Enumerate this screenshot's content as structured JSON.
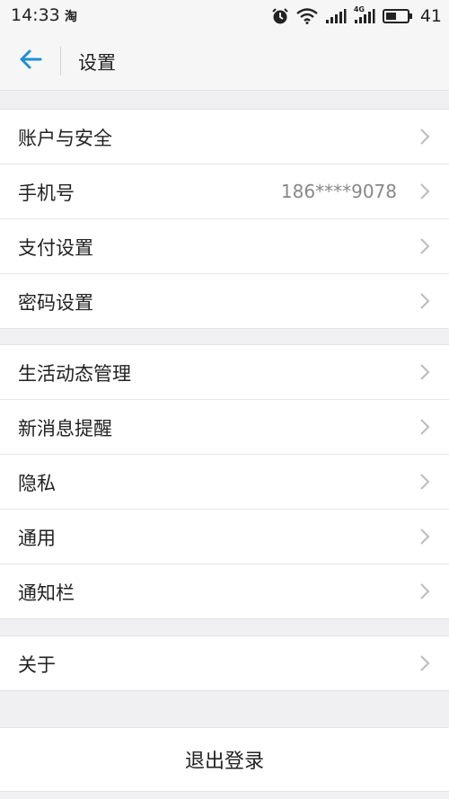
{
  "status_bar": {
    "time": "14:33",
    "app_glyph": "淘",
    "network": "4G",
    "battery_level": "41",
    "icons": [
      "alarm-icon",
      "wifi-icon",
      "signal-icon",
      "signal-4g-icon",
      "battery-icon"
    ]
  },
  "header": {
    "title": "设置",
    "back_icon": "back-arrow-icon",
    "accent_color": "#1e8fd6"
  },
  "groups": [
    {
      "items": [
        {
          "label": "账户与安全",
          "value": ""
        },
        {
          "label": "手机号",
          "value": "186****9078"
        },
        {
          "label": "支付设置",
          "value": ""
        },
        {
          "label": "密码设置",
          "value": ""
        }
      ]
    },
    {
      "items": [
        {
          "label": "生活动态管理",
          "value": ""
        },
        {
          "label": "新消息提醒",
          "value": ""
        },
        {
          "label": "隐私",
          "value": ""
        },
        {
          "label": "通用",
          "value": ""
        },
        {
          "label": "通知栏",
          "value": ""
        }
      ]
    },
    {
      "items": [
        {
          "label": "关于",
          "value": ""
        }
      ]
    }
  ],
  "logout": {
    "label": "退出登录"
  }
}
